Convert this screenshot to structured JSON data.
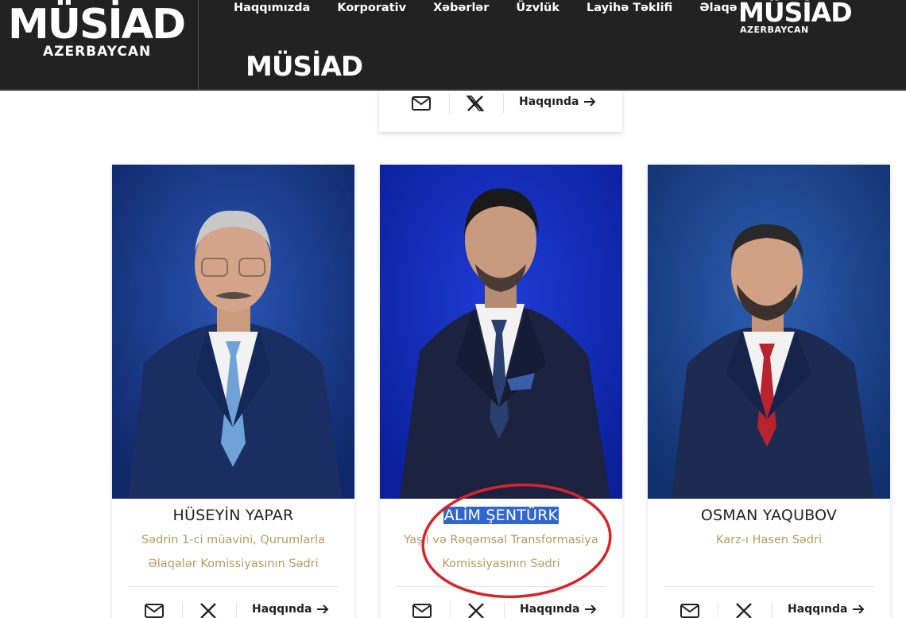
{
  "header": {
    "logo_main": {
      "wordmark": "MÜSİAD",
      "sub": "AZERBAYCAN"
    },
    "nav": [
      {
        "label": "Haqqımızda"
      },
      {
        "label": "Korporativ"
      },
      {
        "label": "Xəbərlər"
      },
      {
        "label": "Üzvlük"
      },
      {
        "label": "Layihə Təklifi"
      },
      {
        "label": "Əlaqə"
      }
    ],
    "logo_right": {
      "wordmark": "MÜSİAD",
      "sub": "AZERBAYCAN"
    },
    "logo_second": {
      "wordmark": "MÜSİAD"
    }
  },
  "top_card": {
    "more_label": "Haqqında"
  },
  "cards": [
    {
      "name": "HÜSEYİN YAPAR",
      "role_line1": "Sədrin 1-ci müavini, Qurumlarla",
      "role_line2": "Əlaqələr Komissiyasının Sədri",
      "more_label": "Haqqında",
      "tie_color": "#6fa3d8",
      "suit_color": "#1a2e63"
    },
    {
      "name": "ALİM ŞENTÜRK",
      "role_line1": "Yaşıl və Rəqəmsal Transformasiya",
      "role_line2": "Komissiyasının Sədri",
      "more_label": "Haqqında",
      "tie_color": "#2b3f6e",
      "suit_color": "#1b2340"
    },
    {
      "name": "OSMAN YAQUBOV",
      "role_line1": "Karz-ı Hasen Sədri",
      "role_line2": "",
      "more_label": "Haqqında",
      "tie_color": "#b8232f",
      "suit_color": "#1d2a52"
    }
  ],
  "colors": {
    "header_bg": "#222222",
    "role_text": "#b59a5e",
    "photo_bg": "#12327e",
    "annotation": "#d8232a",
    "selection": "#2f66d0"
  },
  "icons": {
    "mail": "mail-icon",
    "x": "x-social-icon",
    "arrow": "arrow-right-icon"
  }
}
